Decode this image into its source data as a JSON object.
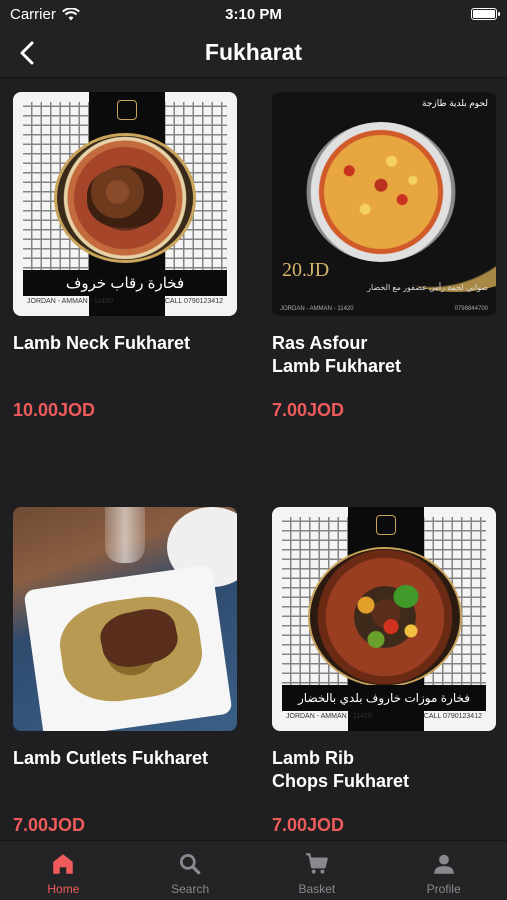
{
  "status": {
    "carrier": "Carrier",
    "time": "3:10 PM"
  },
  "header": {
    "title": "Fukharat"
  },
  "products": [
    {
      "name": "Lamb Neck Fukharet",
      "price": "10.00JOD",
      "image": {
        "banner": "فخارة رقاب خروف",
        "footer_left": "JORDAN - AMMAN - 11420",
        "footer_right": "CALL 0790123412"
      }
    },
    {
      "name": "Ras Asfour\nLamb Fukharet",
      "price": "7.00JOD",
      "image": {
        "top_label": "لحوم بلدية طازجة",
        "price_tag": "20.JD",
        "desc": "صواني لحمة رأس عصفور مع الخضار",
        "footer_left": "JORDAN - AMMAN - 11420",
        "footer_right": "0798844700"
      }
    },
    {
      "name": "Lamb Cutlets Fukharet",
      "price": "7.00JOD",
      "image": {}
    },
    {
      "name": "Lamb Rib\nChops Fukharet",
      "price": "7.00JOD",
      "image": {
        "banner": "فخارة موزات خاروف بلدي بالخضار",
        "footer_left": "JORDAN - AMMAN - 11420",
        "footer_right": "CALL 0790123412"
      }
    }
  ],
  "tabs": [
    {
      "label": "Home",
      "icon": "home-icon",
      "active": true
    },
    {
      "label": "Search",
      "icon": "search-icon",
      "active": false
    },
    {
      "label": "Basket",
      "icon": "cart-icon",
      "active": false
    },
    {
      "label": "Profile",
      "icon": "person-icon",
      "active": false
    }
  ],
  "colors": {
    "accent": "#ef5b5b",
    "background": "#1f1f21",
    "inactive": "#8a8a8e"
  }
}
